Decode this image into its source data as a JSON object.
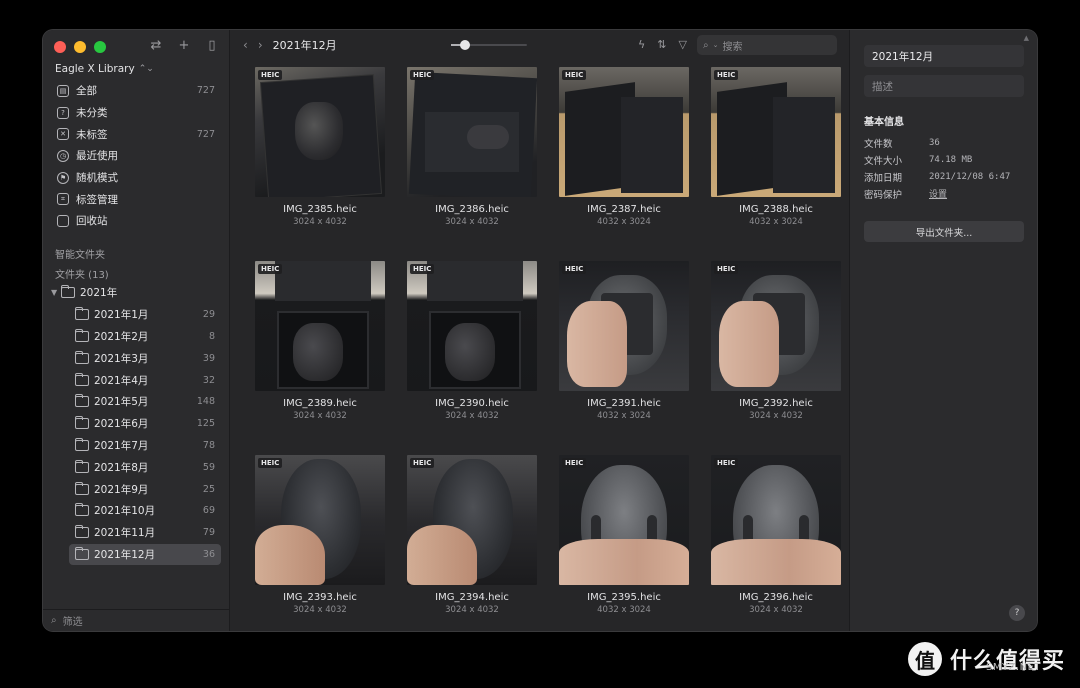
{
  "sidebar": {
    "library_name": "Eagle X Library",
    "items": [
      {
        "label": "全部",
        "count": "727",
        "icon": "all-icon"
      },
      {
        "label": "未分类",
        "count": "",
        "icon": "uncategorized-icon"
      },
      {
        "label": "未标签",
        "count": "727",
        "icon": "untagged-icon"
      },
      {
        "label": "最近使用",
        "count": "",
        "icon": "clock-icon"
      },
      {
        "label": "随机模式",
        "count": "",
        "icon": "random-icon"
      },
      {
        "label": "标签管理",
        "count": "",
        "icon": "tag-manager-icon"
      },
      {
        "label": "回收站",
        "count": "",
        "icon": "trash-icon"
      }
    ],
    "smart_folders": "智能文件夹",
    "folders_header": "文件夹 (13)",
    "year_folder": "2021年",
    "months": [
      {
        "label": "2021年1月",
        "count": "29"
      },
      {
        "label": "2021年2月",
        "count": "8"
      },
      {
        "label": "2021年3月",
        "count": "39"
      },
      {
        "label": "2021年4月",
        "count": "32"
      },
      {
        "label": "2021年5月",
        "count": "148"
      },
      {
        "label": "2021年6月",
        "count": "125"
      },
      {
        "label": "2021年7月",
        "count": "78"
      },
      {
        "label": "2021年8月",
        "count": "59"
      },
      {
        "label": "2021年9月",
        "count": "25"
      },
      {
        "label": "2021年10月",
        "count": "69"
      },
      {
        "label": "2021年11月",
        "count": "79"
      },
      {
        "label": "2021年12月",
        "count": "36"
      }
    ],
    "filter_placeholder": "筛选"
  },
  "toolbar": {
    "title": "2021年12月",
    "search_placeholder": "搜索",
    "zoom_level": 0.18
  },
  "grid": {
    "items": [
      {
        "badge": "HEIC",
        "name": "IMG_2385.heic",
        "dims": "3024 x 4032",
        "style": "p-box"
      },
      {
        "badge": "HEIC",
        "name": "IMG_2386.heic",
        "dims": "3024 x 4032",
        "style": "p-box2"
      },
      {
        "badge": "HEIC",
        "name": "IMG_2387.heic",
        "dims": "4032 x 3024",
        "style": "p-desk"
      },
      {
        "badge": "HEIC",
        "name": "IMG_2388.heic",
        "dims": "4032 x 3024",
        "style": "p-desk"
      },
      {
        "badge": "HEIC",
        "name": "IMG_2389.heic",
        "dims": "3024 x 4032",
        "style": "p-open"
      },
      {
        "badge": "HEIC",
        "name": "IMG_2390.heic",
        "dims": "3024 x 4032",
        "style": "p-open"
      },
      {
        "badge": "HEIC",
        "name": "IMG_2391.heic",
        "dims": "4032 x 3024",
        "style": "p-hand"
      },
      {
        "badge": "HEIC",
        "name": "IMG_2392.heic",
        "dims": "3024 x 4032",
        "style": "p-hand"
      },
      {
        "badge": "HEIC",
        "name": "IMG_2393.heic",
        "dims": "3024 x 4032",
        "style": "p-side"
      },
      {
        "badge": "HEIC",
        "name": "IMG_2394.heic",
        "dims": "3024 x 4032",
        "style": "p-side"
      },
      {
        "badge": "HEIC",
        "name": "IMG_2395.heic",
        "dims": "4032 x 3024",
        "style": "p-bottom"
      },
      {
        "badge": "HEIC",
        "name": "IMG_2396.heic",
        "dims": "3024 x 4032",
        "style": "p-bottom"
      }
    ]
  },
  "inspector": {
    "name_value": "2021年12月",
    "desc_placeholder": "描述",
    "heading": "基本信息",
    "meta": [
      {
        "key": "文件数",
        "value": "36"
      },
      {
        "key": "文件大小",
        "value": "74.18 MB"
      },
      {
        "key": "添加日期",
        "value": "2021/12/08 6:47"
      },
      {
        "key": "密码保护",
        "value": "设置"
      }
    ],
    "export_label": "导出文件夹...",
    "help_label": "?"
  },
  "watermark": {
    "logo": "值",
    "text": "什么值得买",
    "sub": "SMYZ.NET"
  },
  "colors": {
    "window_bg": "#262628",
    "sidebar_bg": "#2b2b2d",
    "active_row": "#48484c",
    "traffic_red": "#fe5f57",
    "traffic_yellow": "#febc2e",
    "traffic_green": "#28c840"
  }
}
